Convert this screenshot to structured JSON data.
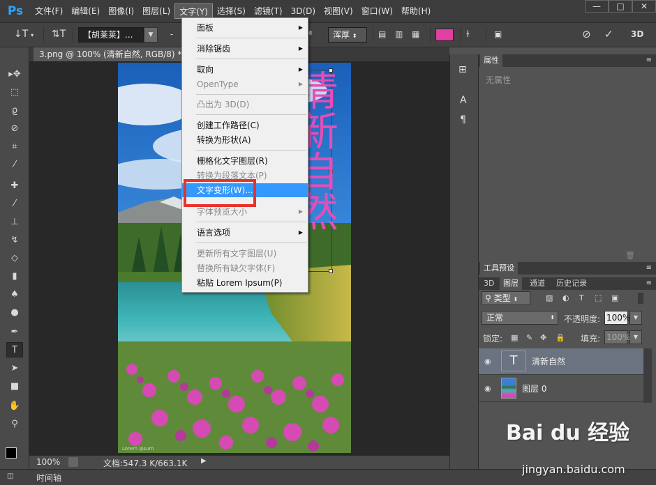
{
  "menubar": {
    "logo": "Ps",
    "items": [
      "文件(F)",
      "编辑(E)",
      "图像(I)",
      "图层(L)",
      "文字(Y)",
      "选择(S)",
      "滤镜(T)",
      "3D(D)",
      "视图(V)",
      "窗口(W)",
      "帮助(H)"
    ],
    "active_index": 4,
    "window_controls": [
      "—",
      "□",
      "✕"
    ]
  },
  "options": {
    "font_family": "【胡莱莱】...",
    "font_style": "-",
    "antialias": "浑厚",
    "aa_prefix": "ª",
    "text_color": "#e040a0",
    "three_d": "3D"
  },
  "document": {
    "tab_title": "3.png @ 100% (清新自然, RGB/8) *",
    "tab_close": "×",
    "zoom": "100%",
    "doc_info": "文档:547.3 K/663.1K",
    "vertical_text": "清新自然",
    "watermark": "Lorem ipsum"
  },
  "menu": {
    "items": [
      {
        "label": "面板",
        "submenu": true,
        "disabled": false
      },
      {
        "label": "消除锯齿",
        "submenu": true,
        "disabled": false
      },
      {
        "label": "取向",
        "submenu": true,
        "disabled": false
      },
      {
        "label": "OpenType",
        "submenu": true,
        "disabled": true
      },
      {
        "label": "凸出为 3D(D)",
        "submenu": false,
        "disabled": true
      },
      {
        "label": "创建工作路径(C)",
        "submenu": false,
        "disabled": false
      },
      {
        "label": "转换为形状(A)",
        "submenu": false,
        "disabled": false
      },
      {
        "label": "栅格化文字图层(R)",
        "submenu": false,
        "disabled": false
      },
      {
        "label": "转换为段落文本(P)",
        "submenu": false,
        "disabled": true
      },
      {
        "label": "文字变形(W)...",
        "submenu": false,
        "disabled": false,
        "highlight": true
      },
      {
        "label": "字体预览大小",
        "submenu": true,
        "disabled": true
      },
      {
        "label": "语言选项",
        "submenu": true,
        "disabled": false
      },
      {
        "label": "更新所有文字图层(U)",
        "submenu": false,
        "disabled": true
      },
      {
        "label": "替换所有缺欠字体(F)",
        "submenu": false,
        "disabled": true
      },
      {
        "label": "粘贴 Lorem Ipsum(P)",
        "submenu": false,
        "disabled": false
      }
    ]
  },
  "properties_panel": {
    "title": "属性",
    "empty_text": "无属性"
  },
  "tool_presets_panel": {
    "title": "工具预设"
  },
  "layers_panel": {
    "tabs": [
      "3D",
      "图层",
      "通道",
      "历史记录"
    ],
    "active_tab": 1,
    "filter_label": "类型",
    "blend_mode": "正常",
    "opacity_label": "不透明度:",
    "opacity_value": "100%",
    "lock_label": "锁定:",
    "fill_label": "填充:",
    "fill_value": "100%",
    "layers": [
      {
        "name": "清新自然",
        "type": "text",
        "thumb": "T",
        "selected": true
      },
      {
        "name": "图层 0",
        "type": "image",
        "thumb": "",
        "selected": false
      }
    ]
  },
  "timeline": {
    "label": "时间轴"
  },
  "footer_watermark": {
    "brand": "Bai du 经验",
    "url": "jingyan.baidu.com"
  }
}
